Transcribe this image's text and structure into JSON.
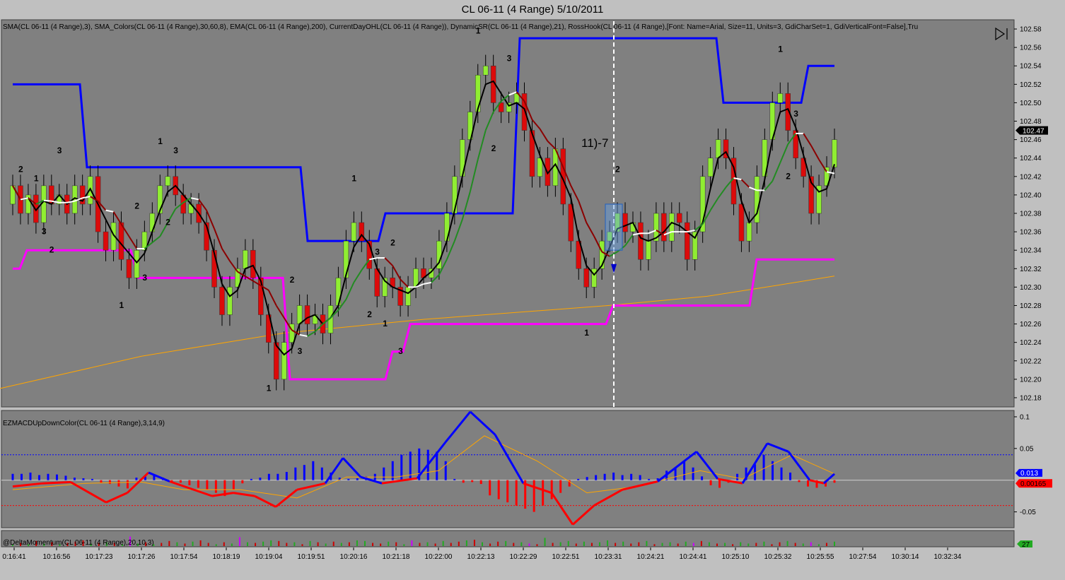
{
  "window": {
    "title": "CL 06-11 (4 Range)  5/10/2011"
  },
  "colors": {
    "panel_bg": "#808080",
    "bull": "#90ee32",
    "bear": "#dc0a0a",
    "sma_fast": "#000000",
    "sma_up": "#228b22",
    "sma_down": "#8b0000",
    "sma_flat": "#ffffff",
    "ema200": "#ffa500",
    "resistance": "#0000ff",
    "support": "#ff00ff",
    "macd_pos": "#0000ff",
    "macd_neg": "#ff0000",
    "macd_signal": "#ffa500"
  },
  "chart_data": [
    {
      "type": "candlestick",
      "name": "price-panel",
      "indicator_text": "SMA(CL 06-11 (4 Range),3), SMA_Colors(CL 06-11 (4 Range),30,60,8), EMA(CL 06-11 (4 Range),200), CurrentDayOHL(CL 06-11 (4 Range)), DynamicSR(CL 06-11 (4 Range),21), RossHook(CL 06-11 (4 Range),[Font: Name=Arial, Size=11, Units=3, GdiCharSet=1, GdiVerticalFont=False],Tru",
      "y_ticks": [
        "102.58",
        "102.56",
        "102.54",
        "102.52",
        "102.50",
        "102.48",
        "102.46",
        "102.44",
        "102.42",
        "102.40",
        "102.38",
        "102.36",
        "102.34",
        "102.32",
        "102.30",
        "102.28",
        "102.26",
        "102.24",
        "102.22",
        "102.20",
        "102.18"
      ],
      "ylim": [
        102.17,
        102.59
      ],
      "last_price_label": "102.47",
      "annotation": "11)-7",
      "x_ticks": [
        "0:16:41",
        "10:16:56",
        "10:17:23",
        "10:17:26",
        "10:17:54",
        "10:18:19",
        "10:19:04",
        "10:19:51",
        "10:20:16",
        "10:21:18",
        "10:22:00",
        "10:22:13",
        "10:22:29",
        "10:22:51",
        "10:23:31",
        "10:24:21",
        "10:24:41",
        "10:25:10",
        "10:25:32",
        "10:25:55",
        "10:27:54",
        "10:30:14",
        "10:32:34"
      ],
      "candle_closes": [
        102.41,
        102.38,
        102.4,
        102.37,
        102.41,
        102.39,
        102.4,
        102.38,
        102.41,
        102.39,
        102.42,
        102.36,
        102.34,
        102.37,
        102.33,
        102.31,
        102.34,
        102.36,
        102.38,
        102.41,
        102.42,
        102.4,
        102.38,
        102.39,
        102.37,
        102.34,
        102.3,
        102.27,
        102.3,
        102.32,
        102.34,
        102.31,
        102.27,
        102.24,
        102.2,
        102.24,
        102.26,
        102.28,
        102.26,
        102.27,
        102.25,
        102.28,
        102.31,
        102.35,
        102.37,
        102.35,
        102.32,
        102.29,
        102.31,
        102.3,
        102.28,
        102.3,
        102.32,
        102.31,
        102.32,
        102.35,
        102.38,
        102.42,
        102.46,
        102.49,
        102.53,
        102.54,
        102.5,
        102.49,
        102.5,
        102.51,
        102.47,
        102.42,
        102.44,
        102.41,
        102.45,
        102.39,
        102.35,
        102.32,
        102.3,
        102.32,
        102.35,
        102.36,
        102.38,
        102.36,
        102.37,
        102.33,
        102.35,
        102.38,
        102.35,
        102.38,
        102.37,
        102.33,
        102.36,
        102.42,
        102.44,
        102.46,
        102.44,
        102.39,
        102.35,
        102.37,
        102.42,
        102.46,
        102.5,
        102.51,
        102.47,
        102.44,
        102.42,
        102.38,
        102.41,
        102.43,
        102.46
      ],
      "ema200": [
        [
          0,
          102.19
        ],
        [
          200,
          102.225
        ],
        [
          400,
          102.25
        ],
        [
          600,
          102.265
        ],
        [
          860,
          102.28
        ],
        [
          1000,
          102.29
        ],
        [
          1100,
          102.302
        ],
        [
          1180,
          102.312
        ]
      ],
      "resistance_steps": [
        [
          18,
          102.52
        ],
        [
          113,
          102.52
        ],
        [
          123,
          102.43
        ],
        [
          425,
          102.43
        ],
        [
          435,
          102.35
        ],
        [
          535,
          102.35
        ],
        [
          545,
          102.38
        ],
        [
          725,
          102.38
        ],
        [
          735,
          102.57
        ],
        [
          1013,
          102.57
        ],
        [
          1023,
          102.5
        ],
        [
          1133,
          102.5
        ],
        [
          1143,
          102.54
        ],
        [
          1180,
          102.54
        ]
      ],
      "support_steps": [
        [
          18,
          102.32
        ],
        [
          28,
          102.32
        ],
        [
          38,
          102.34
        ],
        [
          185,
          102.34
        ],
        [
          195,
          102.31
        ],
        [
          400,
          102.31
        ],
        [
          410,
          102.2
        ],
        [
          545,
          102.2
        ],
        [
          555,
          102.23
        ],
        [
          570,
          102.23
        ],
        [
          580,
          102.26
        ],
        [
          857,
          102.26
        ],
        [
          867,
          102.28
        ],
        [
          1060,
          102.28
        ],
        [
          1070,
          102.33
        ],
        [
          1180,
          102.33
        ]
      ],
      "ross_hook_labels": [
        {
          "text": "2",
          "i": 1,
          "pos": "above"
        },
        {
          "text": "1",
          "i": 3,
          "pos": "above"
        },
        {
          "text": "3",
          "i": 4,
          "pos": "below"
        },
        {
          "text": "2",
          "i": 5,
          "pos": "below"
        },
        {
          "text": "3",
          "i": 6,
          "pos": "above"
        },
        {
          "text": "2",
          "i": 16,
          "pos": "above"
        },
        {
          "text": "1",
          "i": 14,
          "pos": "below"
        },
        {
          "text": "3",
          "i": 17,
          "pos": "below"
        },
        {
          "text": "1",
          "i": 19,
          "pos": "above"
        },
        {
          "text": "3",
          "i": 21,
          "pos": "above"
        },
        {
          "text": "2",
          "i": 20,
          "pos": "below"
        },
        {
          "text": "1",
          "i": 33,
          "pos": "below"
        },
        {
          "text": "2",
          "i": 36,
          "pos": "above"
        },
        {
          "text": "3",
          "i": 37,
          "pos": "below"
        },
        {
          "text": "1",
          "i": 44,
          "pos": "above"
        },
        {
          "text": "3",
          "i": 47,
          "pos": "above"
        },
        {
          "text": "2",
          "i": 46,
          "pos": "below"
        },
        {
          "text": "1",
          "i": 48,
          "pos": "below"
        },
        {
          "text": "3",
          "i": 50,
          "pos": "below"
        },
        {
          "text": "2",
          "i": 49,
          "pos": "above"
        },
        {
          "text": "1",
          "i": 60,
          "pos": "above"
        },
        {
          "text": "3",
          "i": 64,
          "pos": "above"
        },
        {
          "text": "2",
          "i": 62,
          "pos": "below"
        },
        {
          "text": "1",
          "i": 74,
          "pos": "below"
        },
        {
          "text": "2",
          "i": 78,
          "pos": "above"
        },
        {
          "text": "1",
          "i": 99,
          "pos": "above"
        },
        {
          "text": "3",
          "i": 101,
          "pos": "above"
        },
        {
          "text": "2",
          "i": 100,
          "pos": "below"
        }
      ]
    },
    {
      "type": "histogram_line",
      "name": "macd-panel",
      "indicator_text": "EZMACDUpDownColor(CL 06-11 (4 Range),3,14,9)",
      "y_ticks": [
        "0.1",
        "0.05",
        "-0.05"
      ],
      "ylim": [
        -0.075,
        0.11
      ],
      "upper_level": 0.04,
      "lower_level": -0.04,
      "value_labels": [
        "0.013",
        "0.00165"
      ],
      "macd_line": [
        [
          18,
          -0.01
        ],
        [
          60,
          -0.005
        ],
        [
          100,
          -0.003
        ],
        [
          150,
          -0.035
        ],
        [
          180,
          -0.02
        ],
        [
          210,
          0.012
        ],
        [
          240,
          -0.002
        ],
        [
          300,
          -0.025
        ],
        [
          330,
          -0.02
        ],
        [
          360,
          -0.025
        ],
        [
          390,
          -0.042
        ],
        [
          420,
          -0.015
        ],
        [
          460,
          -0.005
        ],
        [
          485,
          0.035
        ],
        [
          510,
          0.005
        ],
        [
          540,
          -0.005
        ],
        [
          590,
          0.003
        ],
        [
          630,
          0.06
        ],
        [
          665,
          0.108
        ],
        [
          700,
          0.072
        ],
        [
          740,
          -0.005
        ],
        [
          780,
          -0.02
        ],
        [
          810,
          -0.07
        ],
        [
          840,
          -0.04
        ],
        [
          880,
          -0.015
        ],
        [
          930,
          -0.002
        ],
        [
          985,
          0.045
        ],
        [
          1015,
          0.002
        ],
        [
          1050,
          -0.005
        ],
        [
          1085,
          0.058
        ],
        [
          1115,
          0.045
        ],
        [
          1145,
          0.0
        ],
        [
          1165,
          -0.005
        ],
        [
          1180,
          0.01
        ]
      ],
      "signal_line": [
        [
          18,
          -0.015
        ],
        [
          120,
          -0.005
        ],
        [
          200,
          -0.003
        ],
        [
          260,
          -0.015
        ],
        [
          340,
          -0.015
        ],
        [
          420,
          -0.028
        ],
        [
          490,
          0.005
        ],
        [
          560,
          0.005
        ],
        [
          620,
          0.015
        ],
        [
          685,
          0.07
        ],
        [
          760,
          0.03
        ],
        [
          830,
          -0.02
        ],
        [
          900,
          -0.01
        ],
        [
          990,
          0.015
        ],
        [
          1050,
          0.002
        ],
        [
          1120,
          0.04
        ],
        [
          1180,
          0.01
        ]
      ],
      "histogram": [
        0.01,
        0.01,
        0.012,
        0.008,
        0.01,
        0.009,
        0.007,
        0.004,
        0.003,
        0.002,
        -0.004,
        -0.006,
        -0.01,
        -0.013,
        0.004,
        0.006,
        0.009,
        0.004,
        -0.002,
        -0.004,
        -0.008,
        -0.012,
        -0.015,
        -0.02,
        -0.025,
        -0.015,
        -0.005,
        0.002,
        0.004,
        0.01,
        0.01,
        0.013,
        0.02,
        0.024,
        0.03,
        0.02,
        0.012,
        0.004,
        0.002,
        0.003,
        0.006,
        0.01,
        0.02,
        0.03,
        0.04,
        0.045,
        0.05,
        0.048,
        0.045,
        0.03,
        0.002,
        -0.004,
        -0.003,
        -0.006,
        -0.024,
        -0.03,
        -0.035,
        -0.04,
        -0.045,
        -0.05,
        -0.04,
        -0.03,
        -0.02,
        -0.01,
        0.002,
        0.005,
        0.008,
        0.01,
        0.012,
        0.008,
        0.01,
        0.008,
        0.002,
        0.003,
        0.015,
        0.02,
        0.03,
        0.02,
        0.006,
        -0.008,
        -0.012,
        -0.004,
        0.01,
        0.02,
        0.025,
        0.04,
        0.03,
        0.02,
        0.012,
        -0.003,
        -0.01,
        -0.012,
        -0.01,
        -0.004
      ]
    },
    {
      "type": "bar",
      "name": "delta-panel",
      "indicator_text": "@DeltaMomentum(CL 06-11 (4 Range),20,10,3)",
      "value_label": "27",
      "bars": [
        0.2,
        0.5,
        0.3,
        0.8,
        0.4,
        0.6,
        0.3,
        0.5,
        0.7,
        0.9,
        0.4,
        0.5,
        0.6,
        0.5,
        0.3,
        1.5,
        0.4,
        0.6,
        0.3,
        0.5,
        0.8,
        0.6,
        0.4,
        0.7,
        0.9,
        0.5,
        0.3,
        0.6,
        0.4,
        1.4,
        0.6,
        0.5,
        0.7,
        0.9,
        0.8,
        0.5,
        0.6,
        0.3,
        0.8,
        0.6,
        0.4,
        0.7,
        0.5,
        0.6,
        0.9,
        0.8,
        0.5,
        0.4,
        0.7,
        0.6,
        0.3,
        0.9,
        0.5,
        0.6,
        0.4,
        0.8,
        0.5,
        0.7,
        0.9,
        1.0,
        0.6,
        0.4,
        0.7,
        0.8,
        0.5,
        0.6,
        0.4,
        0.3,
        1.3,
        0.5,
        0.6,
        0.8,
        0.4,
        0.7,
        0.5,
        0.6,
        0.9,
        0.5,
        0.7,
        0.4,
        0.6,
        0.8,
        0.3,
        0.5,
        0.6,
        0.4,
        0.7,
        0.5,
        0.8,
        0.6,
        0.4,
        0.5,
        0.3,
        0.6,
        0.4,
        0.5,
        0.7,
        0.3,
        0.6,
        0.8,
        0.5,
        0.4,
        0.6,
        0.3,
        0.5,
        0.7
      ],
      "bar_colors": [
        "g",
        "r",
        "g",
        "r",
        "g",
        "r",
        "g",
        "r",
        "r",
        "r",
        "g",
        "r",
        "g",
        "r",
        "g",
        "m",
        "g",
        "r",
        "g",
        "r",
        "r",
        "g",
        "r",
        "g",
        "r",
        "r",
        "g",
        "r",
        "g",
        "m",
        "g",
        "r",
        "g",
        "g",
        "r",
        "r",
        "g",
        "r",
        "g",
        "r",
        "g",
        "r",
        "g",
        "r",
        "g",
        "g",
        "r",
        "r",
        "g",
        "r",
        "g",
        "m",
        "r",
        "g",
        "r",
        "g",
        "r",
        "r",
        "g",
        "r",
        "g",
        "r",
        "r",
        "g",
        "r",
        "g",
        "m",
        "r",
        "g",
        "r",
        "g",
        "g",
        "r",
        "g",
        "r",
        "g",
        "g",
        "r",
        "g",
        "r",
        "r",
        "g",
        "r",
        "g",
        "g",
        "r",
        "g",
        "m",
        "r",
        "g",
        "r",
        "g",
        "r",
        "g",
        "g",
        "r",
        "g",
        "r",
        "r",
        "g",
        "r",
        "g",
        "m",
        "g",
        "r",
        "g"
      ]
    }
  ]
}
